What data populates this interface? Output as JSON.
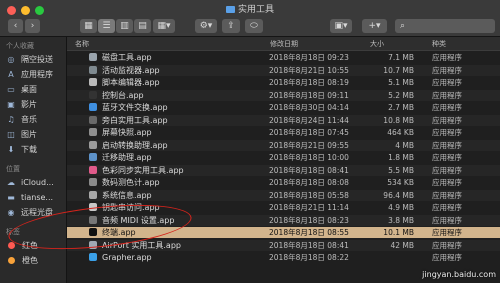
{
  "window": {
    "title": "实用工具"
  },
  "toolbar": {
    "back": "‹",
    "forward": "›",
    "gear": "⚙",
    "share": "⇪",
    "tag": "⬭",
    "add": "+"
  },
  "sidebar": {
    "sections": [
      {
        "header": "个人收藏",
        "items": [
          {
            "label": "隔空投送",
            "icon": "airdrop-icon",
            "glyph": "◎"
          },
          {
            "label": "应用程序",
            "icon": "applications-icon",
            "glyph": "A"
          },
          {
            "label": "桌面",
            "icon": "desktop-icon",
            "glyph": "▭"
          },
          {
            "label": "影片",
            "icon": "movies-icon",
            "glyph": "▣"
          },
          {
            "label": "音乐",
            "icon": "music-icon",
            "glyph": "♫"
          },
          {
            "label": "图片",
            "icon": "pictures-icon",
            "glyph": "◫"
          },
          {
            "label": "下载",
            "icon": "downloads-icon",
            "glyph": "⬇"
          }
        ]
      },
      {
        "header": "位置",
        "items": [
          {
            "label": "iCloud...",
            "icon": "cloud-icon",
            "glyph": "☁"
          },
          {
            "label": "tianse...",
            "icon": "computer-icon",
            "glyph": "▬"
          },
          {
            "label": "远程光盘",
            "icon": "disc-icon",
            "glyph": "◉"
          }
        ]
      },
      {
        "header": "标签",
        "items": [
          {
            "label": "红色",
            "color": "#ff5a52"
          },
          {
            "label": "橙色",
            "color": "#f8a23a"
          }
        ]
      }
    ]
  },
  "columns": {
    "name": "名称",
    "date": "修改日期",
    "size": "大小",
    "kind": "种类"
  },
  "files": [
    {
      "name": "磁盘工具.app",
      "date": "2018年8月18日 09:23",
      "size": "7.1 MB",
      "kind": "应用程序",
      "color": "#9aa4ad"
    },
    {
      "name": "活动监视器.app",
      "date": "2018年8月21日 10:55",
      "size": "10.7 MB",
      "kind": "应用程序",
      "color": "#7f8a90"
    },
    {
      "name": "脚本编辑器.app",
      "date": "2018年8月18日 08:19",
      "size": "5.1 MB",
      "kind": "应用程序",
      "color": "#b9b9b9"
    },
    {
      "name": "控制台.app",
      "date": "2018年8月18日 09:11",
      "size": "5.2 MB",
      "kind": "应用程序",
      "color": "#333333"
    },
    {
      "name": "蓝牙文件交换.app",
      "date": "2018年8月30日 04:14",
      "size": "2.7 MB",
      "kind": "应用程序",
      "color": "#3f8fe0"
    },
    {
      "name": "旁白实用工具.app",
      "date": "2018年8月24日 11:44",
      "size": "10.8 MB",
      "kind": "应用程序",
      "color": "#6a6a6a"
    },
    {
      "name": "屏幕快照.app",
      "date": "2018年8月18日 07:45",
      "size": "464 KB",
      "kind": "应用程序",
      "color": "#8e8e8e"
    },
    {
      "name": "启动转换助理.app",
      "date": "2018年8月21日 09:55",
      "size": "4 MB",
      "kind": "应用程序",
      "color": "#9b9b9b"
    },
    {
      "name": "迁移助理.app",
      "date": "2018年8月18日 10:00",
      "size": "1.8 MB",
      "kind": "应用程序",
      "color": "#5d92c9"
    },
    {
      "name": "色彩同步实用工具.app",
      "date": "2018年8月18日 08:41",
      "size": "5.5 MB",
      "kind": "应用程序",
      "color": "#e05a8a"
    },
    {
      "name": "数码测色计.app",
      "date": "2018年8月18日 08:08",
      "size": "534 KB",
      "kind": "应用程序",
      "color": "#8a8a8a"
    },
    {
      "name": "系统信息.app",
      "date": "2018年8月18日 05:58",
      "size": "96.4 MB",
      "kind": "应用程序",
      "color": "#a8a8a8"
    },
    {
      "name": "钥匙串访问.app",
      "date": "2018年8月21日 11:14",
      "size": "4.9 MB",
      "kind": "应用程序",
      "color": "#c7c7c7"
    },
    {
      "name": "音频 MIDI 设置.app",
      "date": "2018年8月18日 08:23",
      "size": "3.8 MB",
      "kind": "应用程序",
      "color": "#777777"
    },
    {
      "name": "终端.app",
      "date": "2018年8月18日 08:55",
      "size": "10.1 MB",
      "kind": "应用程序",
      "color": "#111111"
    },
    {
      "name": "AirPort 实用工具.app",
      "date": "2018年8月18日 08:41",
      "size": "42 MB",
      "kind": "应用程序",
      "color": "#9fa8b2"
    },
    {
      "name": "Grapher.app",
      "date": "2018年8月18日 08:22",
      "size": "",
      "kind": "应用程序",
      "color": "#3aa0e8"
    }
  ],
  "selected_index": 14,
  "watermark": "jingyan.baidu.com"
}
